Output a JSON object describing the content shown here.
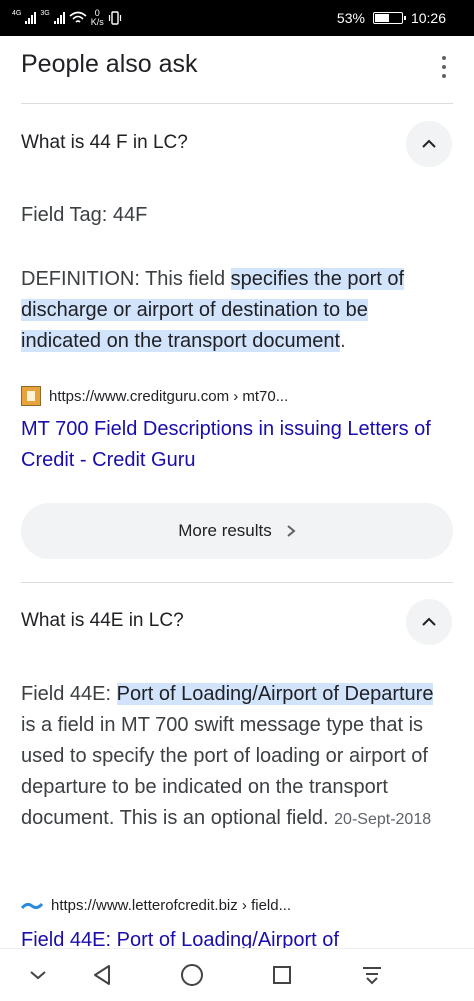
{
  "status_bar": {
    "network1": "4G",
    "network2": "3G",
    "speed_value": "0",
    "speed_unit": "K/s",
    "battery_percent": "53%",
    "battery_level": 0.53,
    "time": "10:26"
  },
  "header": {
    "title": "People also ask",
    "menu_icon": "more-vert-icon"
  },
  "questions": [
    {
      "question": "What is 44 F in LC?",
      "toggle_icon": "chevron-up-icon",
      "field_tag": "Field Tag: 44F",
      "definition_prefix": "DEFINITION: This field ",
      "definition_highlight": "specifies the port of discharge or airport of destination to be indicated on the transport document",
      "definition_suffix": ".",
      "source_url": "https://www.creditguru.com › mt70...",
      "source_title": "MT 700 Field Descriptions in issuing Letters of Credit - Credit Guru"
    },
    {
      "question": "What is 44E in LC?",
      "toggle_icon": "chevron-up-icon",
      "answer_prefix": "Field 44E: ",
      "answer_highlight": "Port of Loading/Airport of Departure",
      "answer_suffix": " is a field in MT 700 swift message type that is used to specify the port of loading or airport of departure to be indicated on the transport document. This is an optional field.",
      "date": "20-Sept-2018",
      "source_url": "https://www.letterofcredit.biz › field...",
      "source_title": "Field 44E: Port of Loading/Airport of"
    }
  ],
  "more_results": {
    "label": "More results",
    "icon": "chevron-right-icon"
  },
  "nav_bar": {
    "items": [
      "chevron-down-icon",
      "back-triangle-icon",
      "home-circle-icon",
      "recents-square-icon",
      "notification-pull-icon"
    ]
  },
  "colors": {
    "highlight": "#d2e3fc",
    "link": "#1a0dab",
    "button_bg": "#f1f3f4",
    "divider": "#dadce0"
  }
}
